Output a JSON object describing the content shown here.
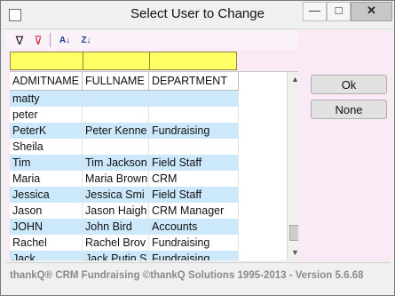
{
  "window": {
    "title": "Select User to Change",
    "controls": {
      "minimize": "—",
      "maximize": "□",
      "close": "✕"
    }
  },
  "toolbar": {
    "filter_icon": "filter-icon",
    "clear_filter_icon": "clear-filter-icon",
    "sort_asc_icon": "sort-az-icon",
    "sort_desc_icon": "sort-za-icon",
    "glyphs": {
      "filter": "∇",
      "clear": "⊽",
      "asc": "A↓",
      "desc": "Z↓"
    }
  },
  "grid": {
    "columns": [
      "ADMITNAME",
      "FULLNAME",
      "DEPARTMENT"
    ],
    "rows": [
      [
        "matty",
        "",
        ""
      ],
      [
        "peter",
        "",
        ""
      ],
      [
        "PeterK",
        "Peter Kenne",
        "Fundraising"
      ],
      [
        "Sheila",
        "",
        ""
      ],
      [
        "Tim",
        "Tim Jackson",
        "Field Staff"
      ],
      [
        "Maria",
        "Maria Brown",
        "CRM"
      ],
      [
        "Jessica",
        "Jessica Smi",
        "Field Staff"
      ],
      [
        "Jason",
        "Jason Haigh",
        "CRM Manager"
      ],
      [
        "JOHN",
        "John Bird",
        "Accounts"
      ],
      [
        "Rachel",
        "Rachel Brov",
        "Fundraising"
      ],
      [
        "Jack",
        "Jack Putin S",
        "Fundraising"
      ]
    ]
  },
  "buttons": {
    "ok": "Ok",
    "none": "None"
  },
  "status": {
    "text": "thankQ® CRM Fundraising ©thankQ Solutions 1995-2013 - Version 5.6.68"
  },
  "colors": {
    "filter_row": "#ffff66",
    "row_alt": "#cce8fb",
    "client_bg": "#fbe9f5"
  }
}
